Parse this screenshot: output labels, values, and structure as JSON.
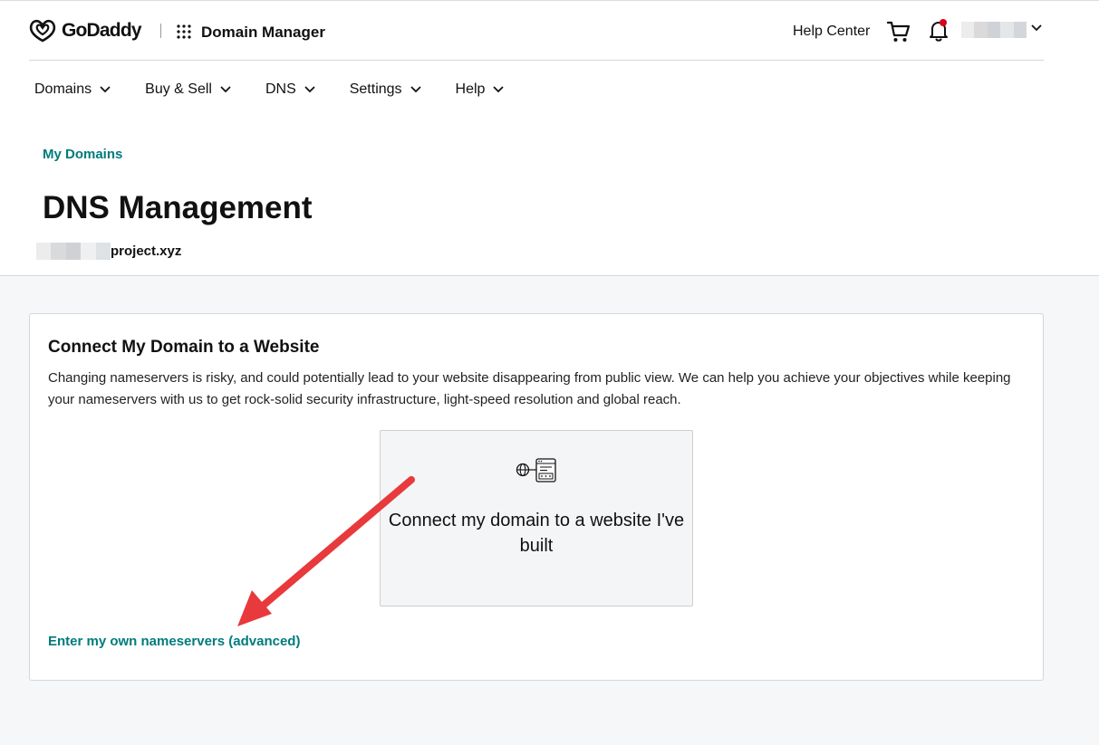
{
  "header": {
    "brand": "GoDaddy",
    "app_title": "Domain Manager",
    "help_center": "Help Center",
    "colors": {
      "accent": "#007b7b",
      "notification": "#d9001b"
    }
  },
  "nav": {
    "items": [
      {
        "label": "Domains"
      },
      {
        "label": "Buy & Sell"
      },
      {
        "label": "DNS"
      },
      {
        "label": "Settings"
      },
      {
        "label": "Help"
      }
    ]
  },
  "page": {
    "breadcrumb": "My Domains",
    "title": "DNS Management",
    "domain_suffix": "project.xyz"
  },
  "card": {
    "title": "Connect My Domain to a Website",
    "description": "Changing nameservers is risky, and could potentially lead to your website disappearing from public view. We can help you achieve your objectives while keeping your nameservers with us to get rock-solid security infrastructure, light-speed resolution and global reach.",
    "option_label": "Connect my domain to a website I've built",
    "option_icon": "globe-server-icon",
    "advanced_link": "Enter my own nameservers (advanced)"
  },
  "annotation": {
    "icon": "red-arrow-icon",
    "color": "#e8393c"
  }
}
